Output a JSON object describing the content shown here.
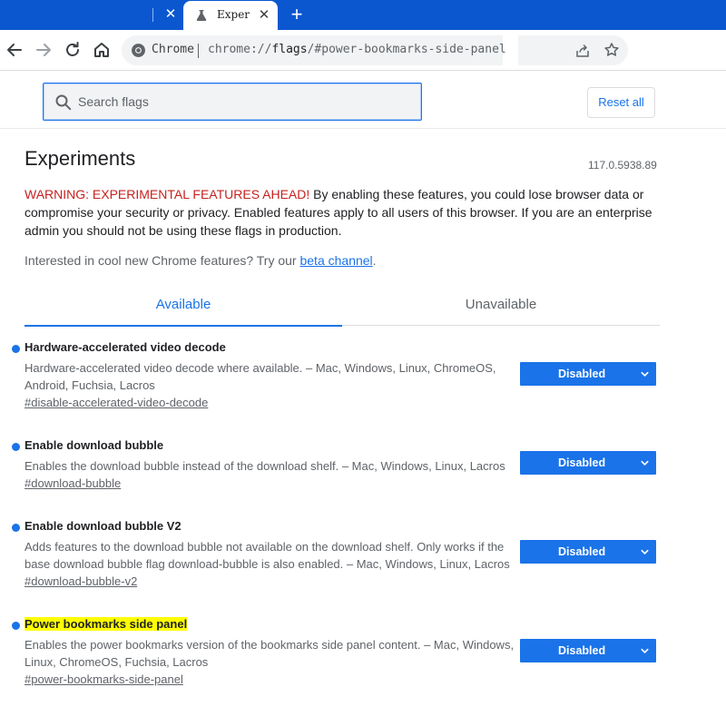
{
  "browser": {
    "inactive_tab": {
      "close_glyph": "✕"
    },
    "active_tab": {
      "title": "Exper",
      "close_glyph": "✕"
    },
    "new_tab_glyph": "+",
    "omnibox": {
      "chip": "Chrome",
      "url_prefix": "chrome://",
      "url_host": "flags",
      "url_path": "/#power-bookmarks-side-panel"
    },
    "accent_color": "#0b57d0"
  },
  "header": {
    "search_placeholder": "Search flags",
    "reset_label": "Reset all"
  },
  "page": {
    "title": "Experiments",
    "version": "117.0.5938.89",
    "warning_strong": "WARNING: EXPERIMENTAL FEATURES AHEAD!",
    "warning_rest": " By enabling these features, you could lose browser data or compromise your security or privacy. Enabled features apply to all users of this browser. If you are an enterprise admin you should not be using these flags in production.",
    "interest_text": "Interested in cool new Chrome features? Try our ",
    "interest_link": "beta channel",
    "interest_end": ".",
    "tabs": [
      {
        "label": "Available"
      },
      {
        "label": "Unavailable"
      }
    ]
  },
  "experiments": [
    {
      "name": "Hardware-accelerated video decode",
      "description": "Hardware-accelerated video decode where available. – Mac, Windows, Linux, ChromeOS, Android, Fuchsia, Lacros",
      "link": "#disable-accelerated-video-decode",
      "value": "Disabled",
      "highlighted": false
    },
    {
      "name": "Enable download bubble",
      "description": "Enables the download bubble instead of the download shelf. – Mac, Windows, Linux, Lacros",
      "link": "#download-bubble",
      "value": "Disabled",
      "highlighted": false
    },
    {
      "name": "Enable download bubble V2",
      "description": "Adds features to the download bubble not available on the download shelf. Only works if the base download bubble flag download-bubble is also enabled. – Mac, Windows, Linux, Lacros",
      "link": "#download-bubble-v2",
      "value": "Disabled",
      "highlighted": false
    },
    {
      "name": "Power bookmarks side panel",
      "description": "Enables the power bookmarks version of the bookmarks side panel content. – Mac, Windows, Linux, ChromeOS, Fuchsia, Lacros",
      "link": "#power-bookmarks-side-panel",
      "value": "Disabled",
      "highlighted": true
    }
  ]
}
